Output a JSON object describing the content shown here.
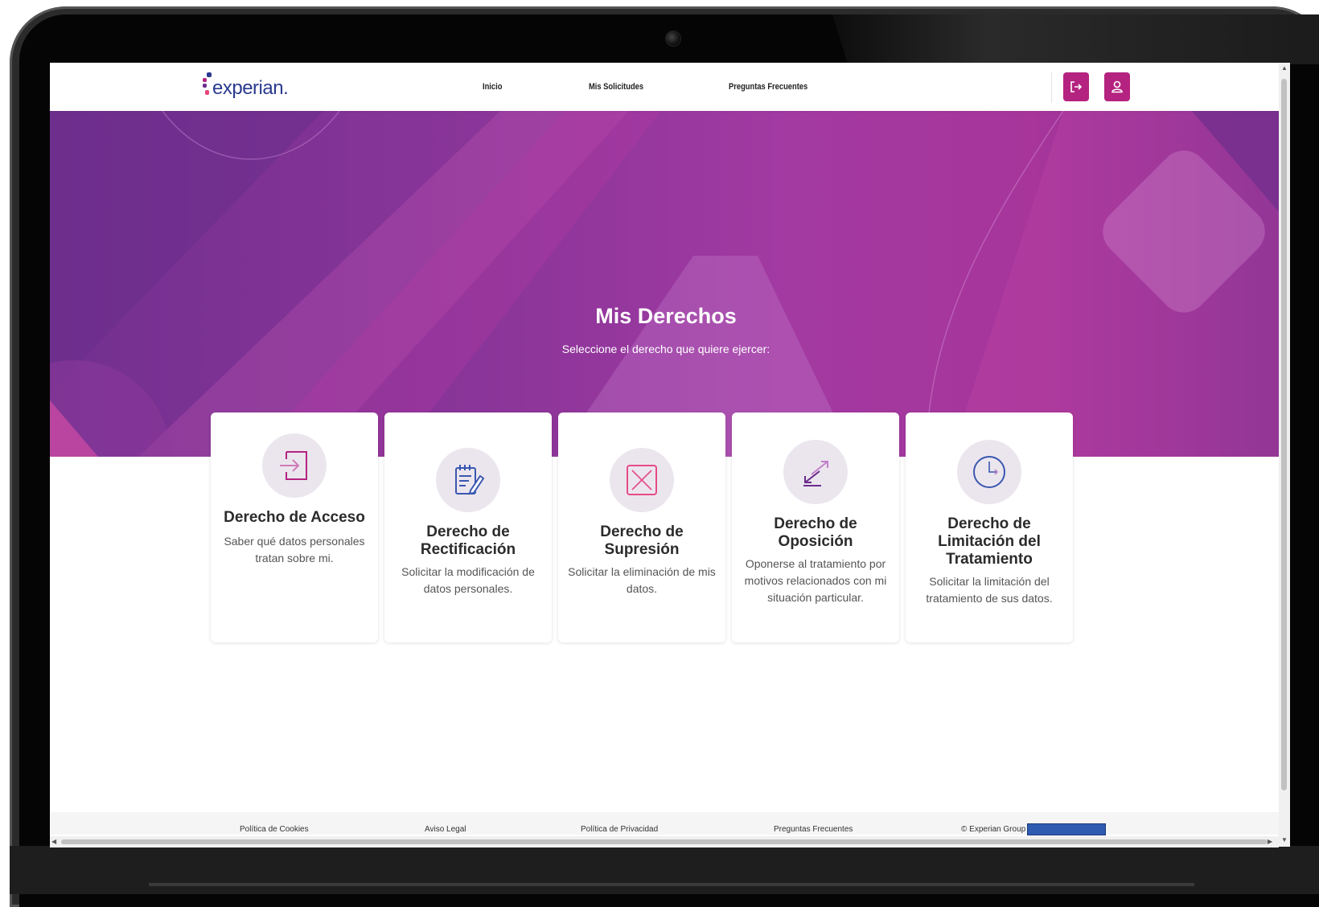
{
  "nav": {
    "logo_text": "experian.",
    "links": [
      "Inicio",
      "Mis Solicitudes",
      "Preguntas Frecuentes"
    ],
    "logout_icon": "logout-icon",
    "profile_icon": "user-icon"
  },
  "hero": {
    "title": "Mis Derechos",
    "subtitle": "Seleccione el derecho que quiere ejercer:"
  },
  "cards": [
    {
      "title": "Derecho de Acceso",
      "desc": "Saber qué datos personales tratan sobre mi.",
      "icon": "enter-icon"
    },
    {
      "title": "Derecho de Rectificación",
      "desc": "Solicitar la modificación de datos personales.",
      "icon": "notepad-edit-icon"
    },
    {
      "title": "Derecho de Supresión",
      "desc": "Solicitar la eliminación de mis datos.",
      "icon": "delete-box-icon"
    },
    {
      "title": "Derecho de Oposición",
      "desc": "Oponerse al tratamiento por motivos relacionados con mi situación particular.",
      "icon": "opposing-arrows-icon"
    },
    {
      "title": "Derecho de Limitación del Tratamiento",
      "desc": "Solicitar la limitación del tratamiento de sus datos.",
      "icon": "clock-icon"
    }
  ],
  "footer": {
    "links": [
      "Política de Cookies",
      "Aviso Legal",
      "Política de Privacidad",
      "Preguntas Frecuentes"
    ],
    "copyright": "© Experian Group -"
  },
  "colors": {
    "brand_magenta": "#b4237f",
    "brand_blue": "#2a3a8e",
    "hero_purple": "#8a3599"
  }
}
